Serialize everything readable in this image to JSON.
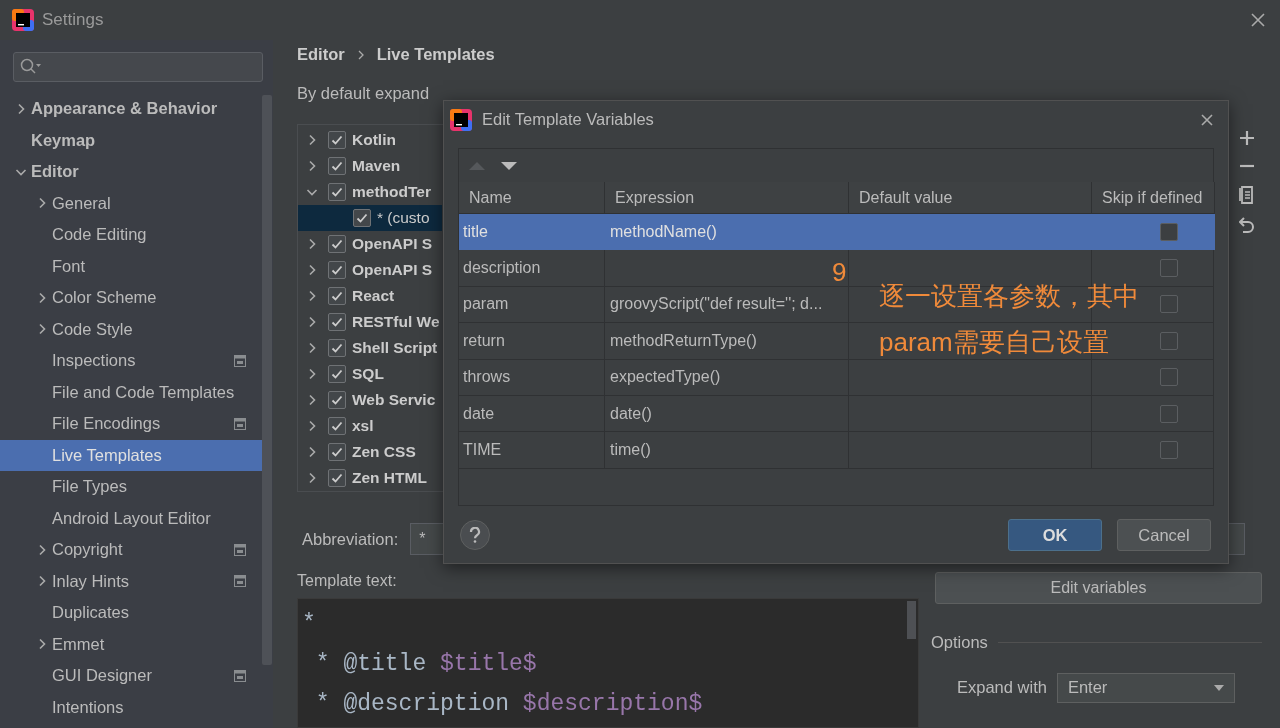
{
  "window": {
    "title": "Settings"
  },
  "sidebar": {
    "items": [
      {
        "label": "Appearance & Behavior",
        "selected": false,
        "expanded": false,
        "scoped": false
      },
      {
        "label": "Keymap",
        "selected": false,
        "scoped": false
      },
      {
        "label": "Editor",
        "selected": false,
        "expanded": true,
        "scoped": false,
        "children": [
          {
            "label": "General",
            "selected": false,
            "expanded": false,
            "scoped": false
          },
          {
            "label": "Code Editing",
            "selected": false,
            "scoped": false
          },
          {
            "label": "Font",
            "selected": false,
            "scoped": false
          },
          {
            "label": "Color Scheme",
            "selected": false,
            "expanded": false,
            "scoped": false
          },
          {
            "label": "Code Style",
            "selected": false,
            "expanded": false,
            "scoped": false
          },
          {
            "label": "Inspections",
            "selected": false,
            "scoped": true
          },
          {
            "label": "File and Code Templates",
            "selected": false,
            "scoped": false
          },
          {
            "label": "File Encodings",
            "selected": false,
            "scoped": true
          },
          {
            "label": "Live Templates",
            "selected": true,
            "scoped": false
          },
          {
            "label": "File Types",
            "selected": false,
            "scoped": false
          },
          {
            "label": "Android Layout Editor",
            "selected": false,
            "scoped": false
          },
          {
            "label": "Copyright",
            "selected": false,
            "expanded": false,
            "scoped": true
          },
          {
            "label": "Inlay Hints",
            "selected": false,
            "expanded": false,
            "scoped": true
          },
          {
            "label": "Duplicates",
            "selected": false,
            "scoped": false
          },
          {
            "label": "Emmet",
            "selected": false,
            "expanded": false,
            "scoped": false
          },
          {
            "label": "GUI Designer",
            "selected": false,
            "scoped": true
          },
          {
            "label": "Intentions",
            "selected": false,
            "scoped": false
          }
        ]
      }
    ]
  },
  "breadcrumb": [
    "Editor",
    "Live Templates"
  ],
  "expand_label": "By default expand",
  "template_groups": [
    {
      "label": "Kotlin",
      "checked": true,
      "expanded": false,
      "selected": false
    },
    {
      "label": "Maven",
      "checked": true,
      "expanded": false,
      "selected": false
    },
    {
      "label": "methodTer",
      "checked": true,
      "expanded": true,
      "selected": false,
      "children": [
        {
          "label": "* (custo",
          "checked": true,
          "selected": true
        }
      ]
    },
    {
      "label": "OpenAPI S",
      "checked": true,
      "expanded": false,
      "selected": false
    },
    {
      "label": "OpenAPI S",
      "checked": true,
      "expanded": false,
      "selected": false
    },
    {
      "label": "React",
      "checked": true,
      "expanded": false,
      "selected": false
    },
    {
      "label": "RESTful We",
      "checked": true,
      "expanded": false,
      "selected": false
    },
    {
      "label": "Shell Script",
      "checked": true,
      "expanded": false,
      "selected": false
    },
    {
      "label": "SQL",
      "checked": true,
      "expanded": false,
      "selected": false
    },
    {
      "label": "Web Servic",
      "checked": true,
      "expanded": false,
      "selected": false
    },
    {
      "label": "xsl",
      "checked": true,
      "expanded": false,
      "selected": false
    },
    {
      "label": "Zen CSS",
      "checked": true,
      "expanded": false,
      "selected": false
    },
    {
      "label": "Zen HTML",
      "checked": true,
      "expanded": false,
      "selected": false
    }
  ],
  "abbreviation": {
    "label": "Abbreviation:",
    "value": "*"
  },
  "template_text": {
    "label": "Template text:",
    "lines": [
      [
        {
          "kind": "plain",
          "text": "*"
        }
      ],
      [
        {
          "kind": "plain",
          "text": " * @title "
        },
        {
          "kind": "variable",
          "text": "$title$"
        }
      ],
      [
        {
          "kind": "plain",
          "text": " * @description "
        },
        {
          "kind": "variable",
          "text": "$description$"
        }
      ]
    ]
  },
  "edit_variables_button": "Edit variables",
  "options": {
    "title": "Options",
    "expand_with": {
      "label": "Expand with",
      "value": "Enter"
    }
  },
  "dialog": {
    "title": "Edit Template Variables",
    "toolbar": [
      {
        "kind": "up",
        "disabled": true
      },
      {
        "kind": "down",
        "disabled": false
      }
    ],
    "columns": [
      "Name",
      "Expression",
      "Default value",
      "Skip if defined"
    ],
    "rows": [
      {
        "name": "title",
        "expression": "methodName()",
        "skip_if_defined": false,
        "selected": true
      },
      {
        "name": "description",
        "skip_if_defined": false,
        "selected": false
      },
      {
        "name": "param",
        "expression": "groovyScript(\"def result=''; d...",
        "skip_if_defined": false,
        "selected": false
      },
      {
        "name": "return",
        "expression": "methodReturnType()",
        "skip_if_defined": false,
        "selected": false
      },
      {
        "name": "throws",
        "expression": "expectedType()",
        "skip_if_defined": false,
        "selected": false
      },
      {
        "name": "date",
        "expression": "date()",
        "skip_if_defined": false,
        "selected": false
      },
      {
        "name": "TIME",
        "expression": "time()",
        "skip_if_defined": false,
        "selected": false
      }
    ],
    "buttons": [
      {
        "label": "OK",
        "kind": "primary"
      },
      {
        "label": "Cancel",
        "kind": "secondary"
      }
    ]
  },
  "annotation": {
    "number": "9",
    "lines": [
      "逐一设置各参数，其中",
      "param需要自己设置"
    ]
  }
}
